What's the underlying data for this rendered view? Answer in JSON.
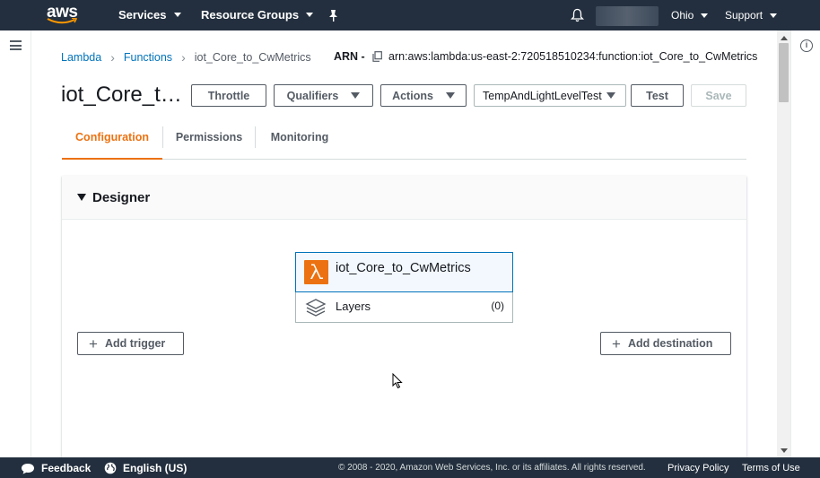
{
  "topnav": {
    "logo_text": "aws",
    "services": "Services",
    "resource_groups": "Resource Groups",
    "region": "Ohio",
    "support": "Support"
  },
  "breadcrumb": {
    "items": [
      "Lambda",
      "Functions",
      "iot_Core_to_CwMetrics"
    ],
    "arn_label": "ARN -",
    "arn_value": "arn:aws:lambda:us-east-2:720518510234:function:iot_Core_to_CwMetrics"
  },
  "header": {
    "title": "iot_Core_t…",
    "throttle": "Throttle",
    "qualifiers": "Qualifiers",
    "actions": "Actions",
    "test_event": "TempAndLightLevelTest",
    "test": "Test",
    "save": "Save"
  },
  "tabs": [
    "Configuration",
    "Permissions",
    "Monitoring"
  ],
  "designer": {
    "title": "Designer",
    "function_name": "iot_Core_to_CwMetrics",
    "layers_label": "Layers",
    "layers_count": "(0)",
    "add_trigger": "Add trigger",
    "add_destination": "Add destination"
  },
  "footer": {
    "feedback": "Feedback",
    "language": "English (US)",
    "copyright": "© 2008 - 2020, Amazon Web Services, Inc. or its affiliates. All rights reserved.",
    "privacy": "Privacy Policy",
    "terms": "Terms of Use"
  },
  "colors": {
    "nav_bg": "#232f3e",
    "accent": "#ec7211",
    "link": "#0073bb"
  }
}
